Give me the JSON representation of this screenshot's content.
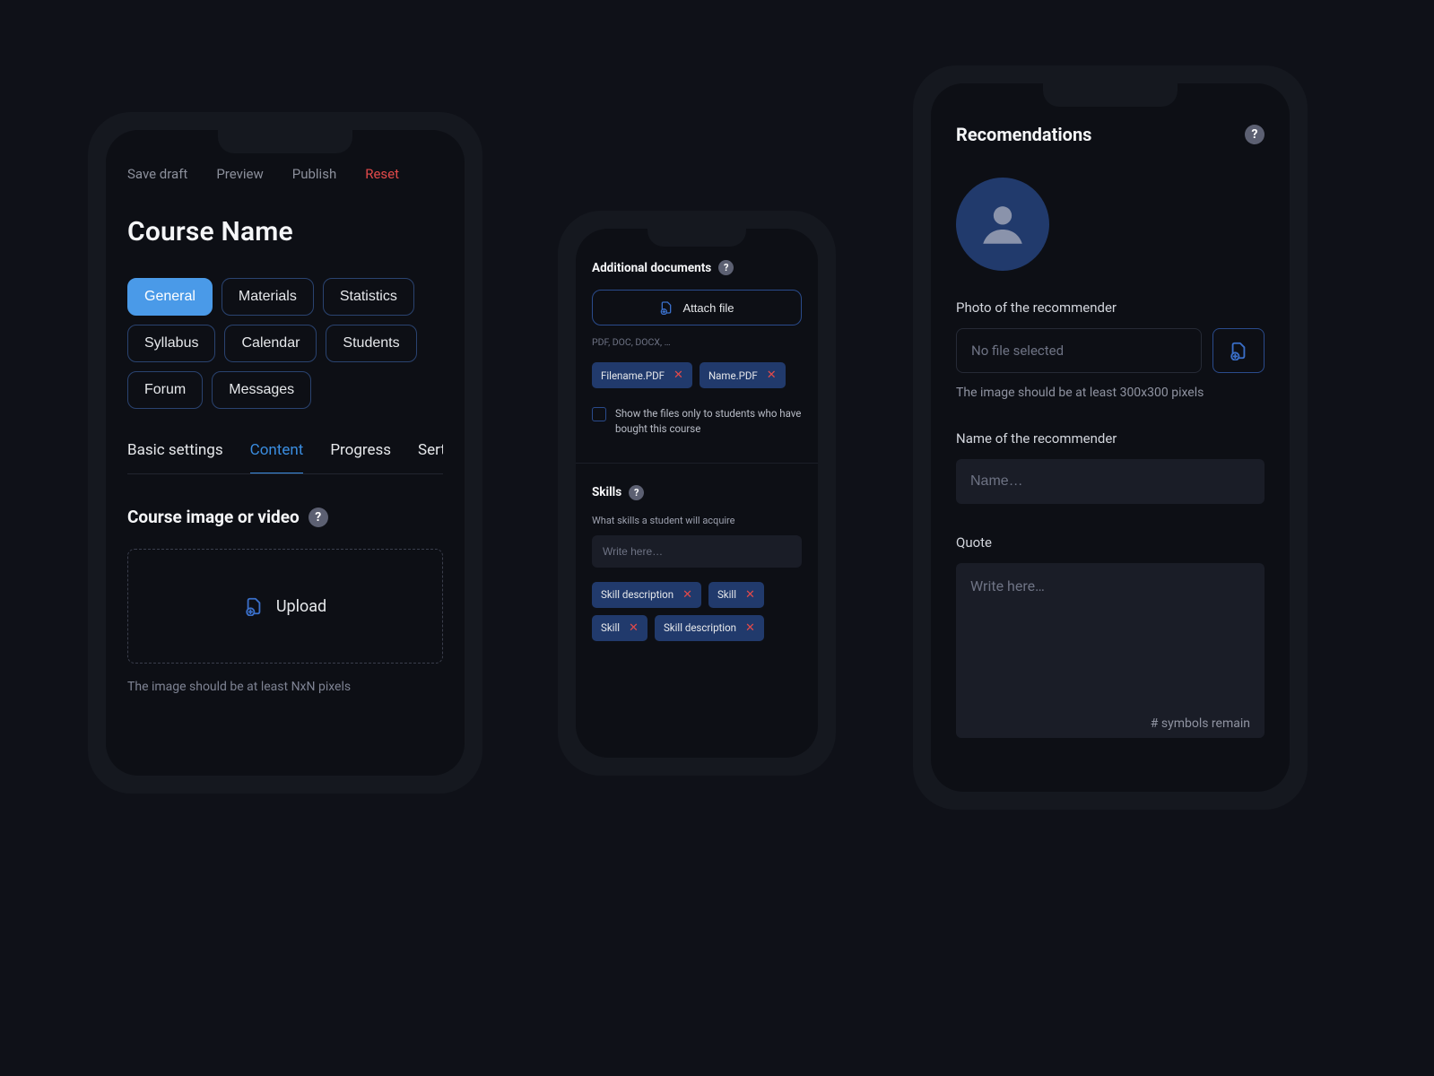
{
  "phone1": {
    "toolbar": {
      "save": "Save draft",
      "preview": "Preview",
      "publish": "Publish",
      "reset": "Reset"
    },
    "title": "Course Name",
    "pills": [
      "General",
      "Materials",
      "Statistics",
      "Syllabus",
      "Calendar",
      "Students",
      "Forum",
      "Messages"
    ],
    "active_pill": "General",
    "subnav": [
      "Basic settings",
      "Content",
      "Progress",
      "Sertificate"
    ],
    "active_subnav": "Content",
    "media_section": {
      "title": "Course image or video",
      "upload_label": "Upload",
      "hint": "The image should be at least NxN pixels"
    }
  },
  "phone2": {
    "docs": {
      "title": "Additional documents",
      "attach_label": "Attach file",
      "formats": "PDF, DOC, DOCX, …",
      "files": [
        "Filename.PDF",
        "Name.PDF"
      ],
      "checkbox_label": "Show the files only to students who have bought this course"
    },
    "skills": {
      "title": "Skills",
      "subtitle": "What skills a student will acquire",
      "placeholder": "Write here…",
      "items": [
        "Skill description",
        "Skill",
        "Skill",
        "Skill description"
      ]
    }
  },
  "phone3": {
    "title": "Recomendations",
    "photo": {
      "label": "Photo of the recommender",
      "no_file": "No file selected",
      "hint": "The image should be at least 300x300 pixels"
    },
    "name": {
      "label": "Name of the recommender",
      "placeholder": "Name…"
    },
    "quote": {
      "label": "Quote",
      "placeholder": "Write here…",
      "remain": "# symbols remain"
    }
  }
}
